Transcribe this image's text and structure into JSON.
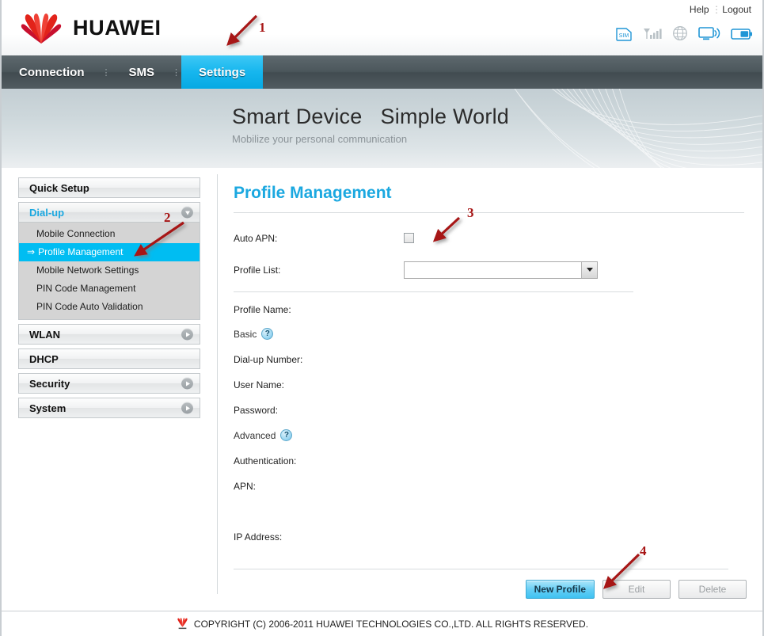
{
  "header": {
    "brand": "HUAWEI",
    "help_label": "Help",
    "logout_label": "Logout",
    "status_icons": [
      "sim-icon",
      "signal-bars-icon",
      "globe-icon",
      "monitor-wifi-icon",
      "battery-icon"
    ]
  },
  "nav": {
    "tabs": [
      {
        "label": "Connection",
        "active": false
      },
      {
        "label": "SMS",
        "active": false
      },
      {
        "label": "Settings",
        "active": true
      }
    ],
    "active_color": "#06a9e3"
  },
  "banner": {
    "title": "Smart Device   Simple World",
    "subtitle": "Mobilize your personal communication"
  },
  "sidebar": {
    "groups": [
      {
        "label": "Quick Setup",
        "chevron": "none",
        "open": false,
        "items": []
      },
      {
        "label": "Dial-up",
        "chevron": "down",
        "open": true,
        "items": [
          {
            "label": "Mobile Connection",
            "selected": false
          },
          {
            "label": "Profile Management",
            "selected": true
          },
          {
            "label": "Mobile Network Settings",
            "selected": false
          },
          {
            "label": "PIN Code Management",
            "selected": false
          },
          {
            "label": "PIN Code Auto Validation",
            "selected": false
          }
        ]
      },
      {
        "label": "WLAN",
        "chevron": "right",
        "open": false,
        "items": []
      },
      {
        "label": "DHCP",
        "chevron": "none",
        "open": false,
        "items": []
      },
      {
        "label": "Security",
        "chevron": "right",
        "open": false,
        "items": []
      },
      {
        "label": "System",
        "chevron": "right",
        "open": false,
        "items": []
      }
    ],
    "selected_color": "#00bdf2"
  },
  "main": {
    "page_title": "Profile Management",
    "auto_apn_label": "Auto APN:",
    "auto_apn_checked": false,
    "profile_list_label": "Profile List:",
    "profile_list_value": "",
    "profile_name_label": "Profile Name:",
    "basic_label": "Basic",
    "dialup_number_label": "Dial-up Number:",
    "user_name_label": "User Name:",
    "password_label": "Password:",
    "advanced_label": "Advanced",
    "authentication_label": "Authentication:",
    "apn_label": "APN:",
    "ip_address_label": "IP Address:",
    "help_glyph": "?",
    "buttons": [
      {
        "label": "New Profile",
        "state": "primary"
      },
      {
        "label": "Edit",
        "state": "disabled"
      },
      {
        "label": "Delete",
        "state": "disabled"
      }
    ]
  },
  "footer": {
    "copyright": "COPYRIGHT (C) 2006-2011 HUAWEI TECHNOLOGIES CO.,LTD. ALL RIGHTS RESERVED."
  },
  "annotations": [
    {
      "number": "1",
      "target": "settings-tab"
    },
    {
      "number": "2",
      "target": "profile-management-item"
    },
    {
      "number": "3",
      "target": "auto-apn-checkbox"
    },
    {
      "number": "4",
      "target": "new-profile-button"
    }
  ]
}
